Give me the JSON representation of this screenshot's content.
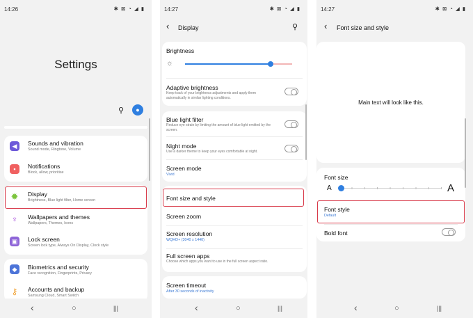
{
  "settings": {
    "time": "14:26",
    "status_icons": "✱ ⊠ ◔ ◢ ▮",
    "title": "Settings",
    "items": [
      {
        "title": "Sounds and vibration",
        "sub": "Sound mode, Ringtone, Volume",
        "icon": "speaker-icon",
        "color": "#6d59d9"
      },
      {
        "title": "Notifications",
        "sub": "Block, allow, prioritise",
        "icon": "bell-icon",
        "color": "#f06060"
      },
      {
        "title": "Display",
        "sub": "Brightness, Blue light filter, Home screen",
        "icon": "sun-icon",
        "color": "#7bc43c"
      },
      {
        "title": "Wallpapers and themes",
        "sub": "Wallpapers, Themes, Icons",
        "icon": "brush-icon",
        "color": "#b060e0"
      },
      {
        "title": "Lock screen",
        "sub": "Screen lock type, Always On Display, Clock style",
        "icon": "lock-icon",
        "color": "#8e65d8"
      },
      {
        "title": "Biometrics and security",
        "sub": "Face recognition, Fingerprints, Privacy",
        "icon": "shield-icon",
        "color": "#4d74d8"
      },
      {
        "title": "Accounts and backup",
        "sub": "Samsung Cloud, Smart Switch",
        "icon": "key-icon",
        "color": "#f0a030"
      }
    ]
  },
  "display": {
    "time": "14:27",
    "status_icons": "✱ ⊠ ◔ ◢ ▮",
    "title": "Display",
    "brightness_label": "Brightness",
    "brightness_level": 0.8,
    "adaptive_title": "Adaptive brightness",
    "adaptive_desc": "Keep track of your brightness adjustments and apply them automatically in similar lighting conditions.",
    "blue_title": "Blue light filter",
    "blue_desc": "Reduce eye strain by limiting the amount of blue light emitted by the screen.",
    "night_title": "Night mode",
    "night_desc": "Use a darker theme to keep your eyes comfortable at night.",
    "screen_mode_title": "Screen mode",
    "screen_mode_value": "Vivid",
    "font_title": "Font size and style",
    "zoom_title": "Screen zoom",
    "resolution_title": "Screen resolution",
    "resolution_value": "WQHD+ (3040 x 1440)",
    "fullscreen_title": "Full screen apps",
    "fullscreen_desc": "Choose which apps you want to use in the full screen aspect ratio.",
    "timeout_title": "Screen timeout",
    "timeout_value": "After 30 seconds of inactivity"
  },
  "font": {
    "time": "14:27",
    "status_icons": "✱ ⊠ ◔ ◢ ▮",
    "title": "Font size and style",
    "preview_text": "Main text will look like this.",
    "size_label": "Font size",
    "size_small": "A",
    "size_large": "A",
    "size_level": 0,
    "style_label": "Font style",
    "style_value": "Default",
    "bold_label": "Bold font"
  },
  "nav": {
    "back": "‹",
    "home": "○",
    "recents": "|||"
  },
  "colors": {
    "accent": "#2f7fe0",
    "highlight": "#d83a4a"
  }
}
